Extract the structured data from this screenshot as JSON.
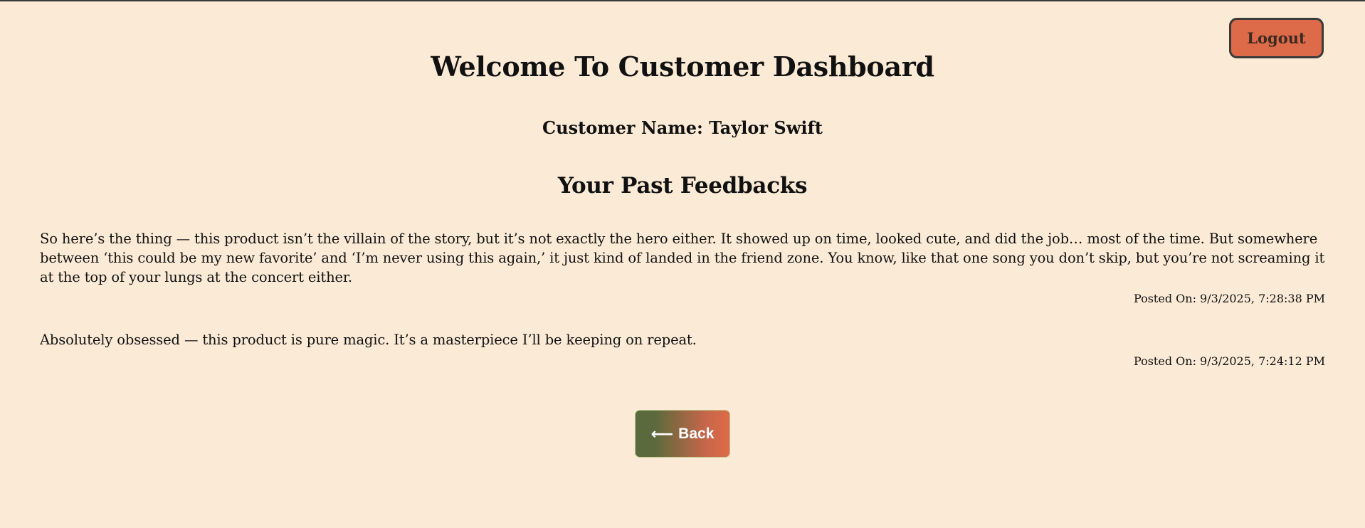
{
  "header": {
    "logout_label": "Logout",
    "title": "Welcome To Customer Dashboard",
    "customer_name": "Customer Name: Taylor Swift"
  },
  "feedbacks": {
    "section_title": "Your Past Feedbacks",
    "items": [
      {
        "text": "So here’s the thing — this product isn’t the villain of the story, but it’s not exactly the hero either. It showed up on time, looked cute, and did the job… most of the time. But somewhere between ‘this could be my new favorite’ and ‘I’m never using this again,’ it just kind of landed in the friend zone. You know, like that one song you don’t skip, but you’re not screaming it at the top of your lungs at the concert either.",
        "posted": "Posted On: 9/3/2025, 7:28:38 PM"
      },
      {
        "text": "Absolutely obsessed — this product is pure magic. It’s a masterpiece I’ll be keeping on repeat.",
        "posted": "Posted On: 9/3/2025, 7:24:12 PM"
      }
    ]
  },
  "footer": {
    "back_arrow": "⟵",
    "back_label": "Back"
  },
  "colors": {
    "background": "#fbebd6",
    "accent": "#dd6a48",
    "olive": "#5a6a3c"
  }
}
